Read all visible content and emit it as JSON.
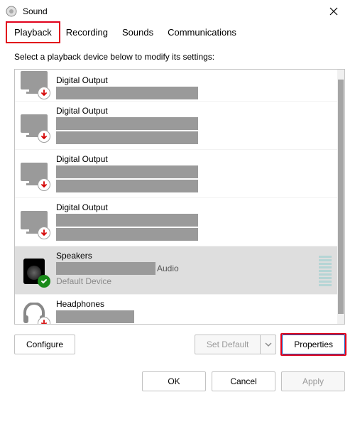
{
  "window": {
    "title": "Sound"
  },
  "tabs": {
    "playback": "Playback",
    "recording": "Recording",
    "sounds": "Sounds",
    "communications": "Communications"
  },
  "hint": "Select a playback device below to modify its settings:",
  "devices": [
    {
      "name": "Digital Output"
    },
    {
      "name": "Digital Output"
    },
    {
      "name": "Digital Output"
    },
    {
      "name": "Digital Output"
    },
    {
      "name": "Speakers",
      "suffix": "Audio",
      "status": "Default Device"
    },
    {
      "name": "Headphones"
    }
  ],
  "buttons": {
    "configure": "Configure",
    "set_default": "Set Default",
    "properties": "Properties",
    "ok": "OK",
    "cancel": "Cancel",
    "apply": "Apply"
  }
}
